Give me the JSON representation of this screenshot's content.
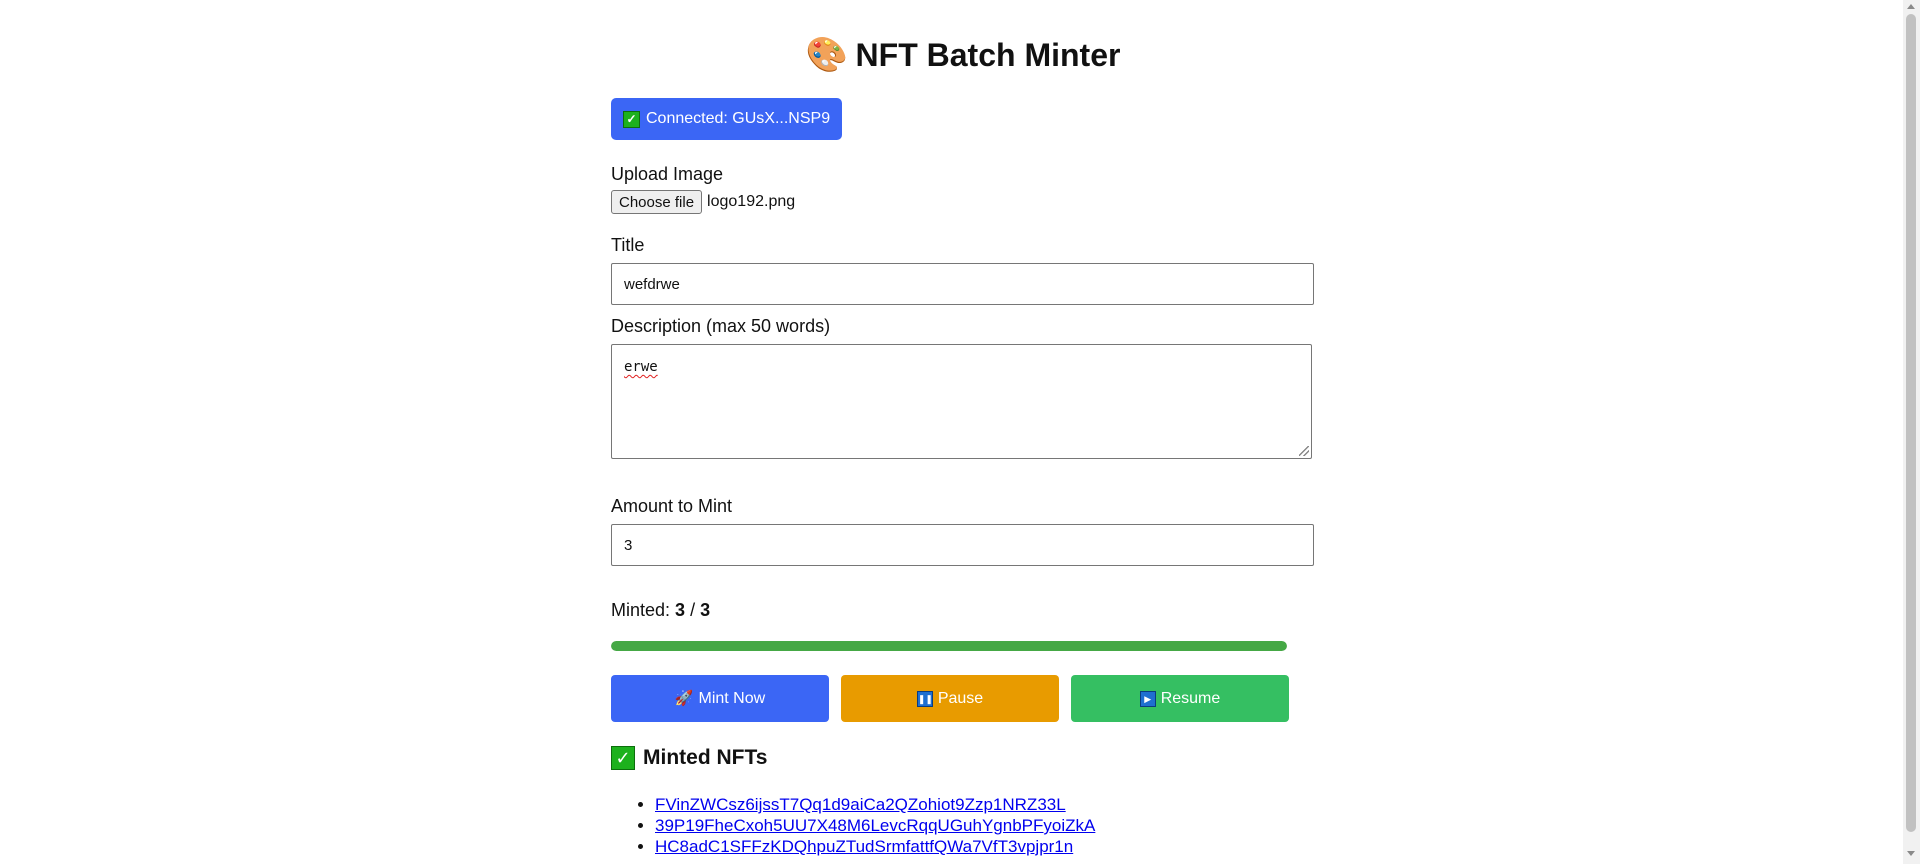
{
  "header": {
    "title": "NFT Batch Minter"
  },
  "wallet": {
    "label": "Connected: GUsX...NSP9"
  },
  "form": {
    "upload_label": "Upload Image",
    "file_button": "Choose file",
    "file_name": "logo192.png",
    "title_label": "Title",
    "title_value": "wefdrwe",
    "description_label": "Description (max 50 words)",
    "description_value": "erwe",
    "amount_label": "Amount to Mint",
    "amount_value": "3"
  },
  "progress": {
    "prefix": "Minted:",
    "minted": "3",
    "separator": "/",
    "total": "3",
    "fraction": 1.0
  },
  "actions": {
    "mint_label": "Mint Now",
    "pause_label": "Pause",
    "resume_label": "Resume"
  },
  "minted_section": {
    "heading": "Minted NFTs",
    "items": [
      "FVinZWCsz6ijssT7Qq1d9aiCa2QZohiot9Zzp1NRZ33L",
      "39P19FheCxoh5UU7X48M6LevcRqqUGuhYgnbPFyoiZkA",
      "HC8adC1SFFzKDQhpuZTudSrmfattfQWa7VfT3vpjpr1n"
    ]
  },
  "colors": {
    "primary": "#3b66f5",
    "pause": "#e89b00",
    "resume": "#35bf62",
    "progress": "#45a845",
    "link": "#0000ee"
  },
  "icons": {
    "title": "palette-icon",
    "wallet": "check-mark-icon",
    "mint": "rocket-icon",
    "pause": "pause-icon",
    "resume": "play-icon",
    "section": "check-mark-icon"
  }
}
